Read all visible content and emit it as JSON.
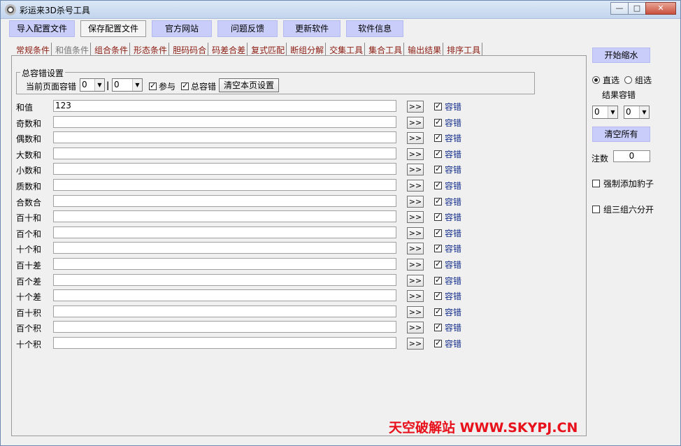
{
  "window": {
    "title": "彩运来3D杀号工具",
    "min_icon": "minimize-icon",
    "max_icon": "maximize-icon",
    "close_icon": "close-icon"
  },
  "toolbar": {
    "buttons": [
      "导入配置文件",
      "保存配置文件",
      "官方网站",
      "问题反馈",
      "更新软件",
      "软件信息"
    ]
  },
  "tabs": [
    "常规条件",
    "和值条件",
    "组合条件",
    "形态条件",
    "胆码码合",
    "码差合差",
    "复式匹配",
    "断组分解",
    "交集工具",
    "集合工具",
    "输出结果",
    "排序工具"
  ],
  "active_tab": "和值条件",
  "group": {
    "title": "总容错设置",
    "label": "当前页面容错",
    "combo1": "0",
    "combo2": "0",
    "participate_label": "参与",
    "total_error_label": "总容错",
    "clear_button": "清空本页设置"
  },
  "rows": [
    {
      "label": "和值",
      "value": "123"
    },
    {
      "label": "奇数和",
      "value": ""
    },
    {
      "label": "偶数和",
      "value": ""
    },
    {
      "label": "大数和",
      "value": ""
    },
    {
      "label": "小数和",
      "value": ""
    },
    {
      "label": "质数和",
      "value": ""
    },
    {
      "label": "合数合",
      "value": ""
    },
    {
      "label": "百十和",
      "value": ""
    },
    {
      "label": "百个和",
      "value": ""
    },
    {
      "label": "十个和",
      "value": ""
    },
    {
      "label": "百十差",
      "value": ""
    },
    {
      "label": "百个差",
      "value": ""
    },
    {
      "label": "十个差",
      "value": ""
    },
    {
      "label": "百十积",
      "value": ""
    },
    {
      "label": "百个积",
      "value": ""
    },
    {
      "label": "十个积",
      "value": ""
    }
  ],
  "row_button_label": ">>",
  "row_check_label": "容错",
  "side": {
    "start_button": "开始缩水",
    "radio_direct": "直选",
    "radio_group": "组选",
    "result_error_label": "结果容错",
    "combo1": "0",
    "combo2": "0",
    "clear_all_button": "清空所有",
    "bets_label": "注数",
    "bets_value": "0",
    "force_label": "强制添加豹子",
    "split_label": "组三组六分开"
  },
  "watermark": "天空破解站 WWW.SKYPJ.CN"
}
